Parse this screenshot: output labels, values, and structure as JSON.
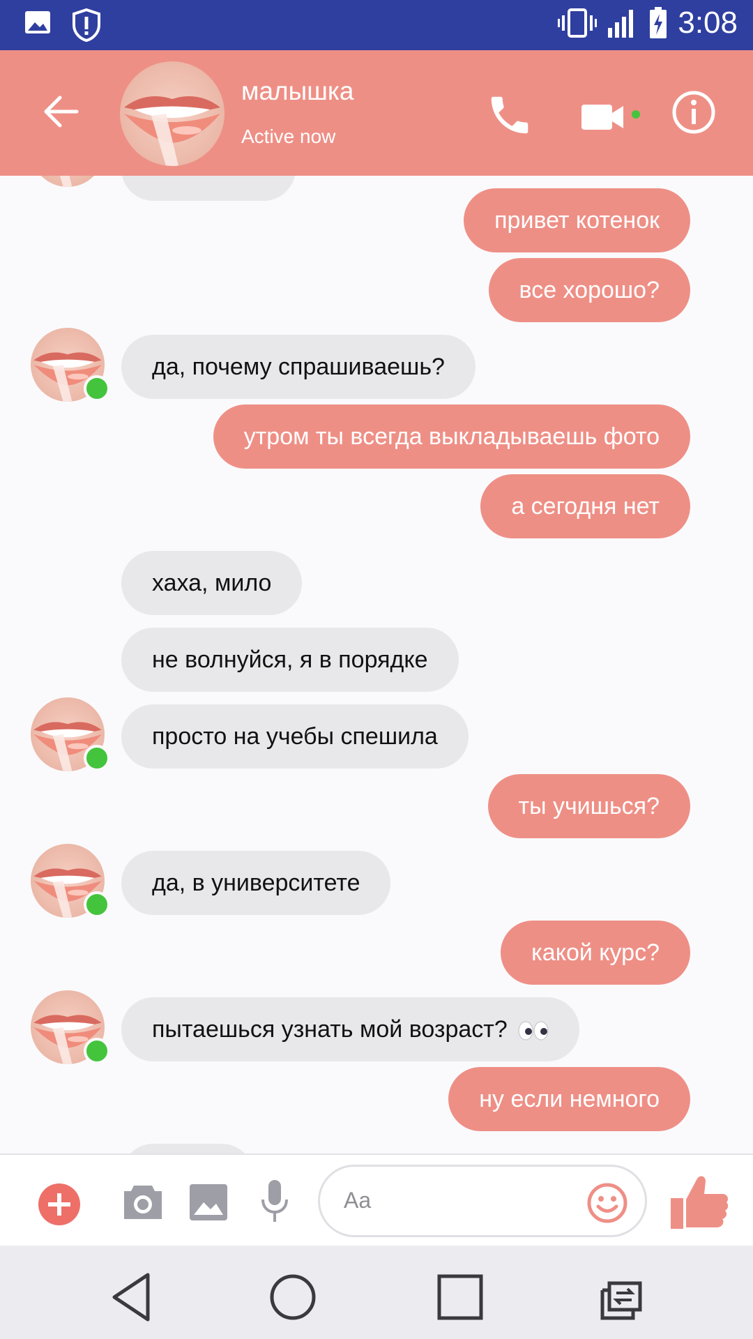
{
  "status_bar": {
    "time": "3:08"
  },
  "header": {
    "contact_name": "малышка",
    "contact_status": "Active now"
  },
  "messages": [
    {
      "dir": "out",
      "text": "привет котенок"
    },
    {
      "dir": "out",
      "text": "все хорошо?"
    },
    {
      "dir": "in",
      "text": "да, почему спрашиваешь?"
    },
    {
      "dir": "out",
      "text": "утром ты всегда выкладываешь фото"
    },
    {
      "dir": "out",
      "text": "а сегодня нет"
    },
    {
      "dir": "in",
      "text": "хаха, мило"
    },
    {
      "dir": "in",
      "text": "не волнуйся, я в порядке"
    },
    {
      "dir": "in",
      "text": "просто на учебы спешила"
    },
    {
      "dir": "out",
      "text": "ты учишься?"
    },
    {
      "dir": "in",
      "text": "да, в университете"
    },
    {
      "dir": "out",
      "text": "какой курс?"
    },
    {
      "dir": "in",
      "text": "пытаешься узнать мой возраст?",
      "emoji": "eyes-emoji"
    },
    {
      "dir": "out",
      "text": "ну если немного"
    }
  ],
  "composer": {
    "placeholder": "Aa"
  },
  "colors": {
    "accent": "#ee8f86",
    "status_bar": "#2f3f9f",
    "online": "#44c43c",
    "incoming_bubble": "#e8e8ea"
  },
  "icons": [
    "back-arrow-icon",
    "phone-icon",
    "video-camera-icon",
    "info-icon",
    "plus-icon",
    "camera-icon",
    "image-icon",
    "microphone-icon",
    "smiley-icon",
    "thumbs-up-icon"
  ]
}
